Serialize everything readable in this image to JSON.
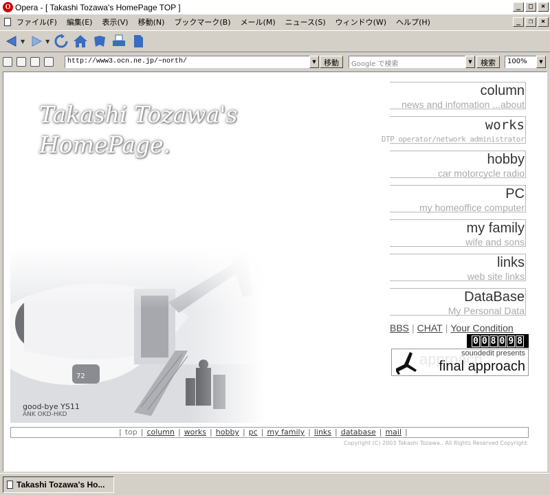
{
  "window": {
    "title": "Opera - [ Takashi Tozawa's HomePage TOP ]",
    "app_icon_glyph": "O"
  },
  "menu": {
    "items": [
      "ファイル(F)",
      "編集(E)",
      "表示(V)",
      "移動(N)",
      "ブックマーク(B)",
      "メール(M)",
      "ニュース(S)",
      "ウィンドウ(W)",
      "ヘルプ(H)"
    ]
  },
  "toolbar": {
    "icons": [
      "back-icon",
      "forward-icon",
      "reload-icon",
      "home-icon",
      "hotlist-icon",
      "print-icon",
      "page-icon"
    ]
  },
  "address": {
    "url": "http://www3.ocn.ne.jp/~north/",
    "go_label": "移動",
    "search_placeholder": "Google で検索",
    "search_label": "検索",
    "zoom": "100%"
  },
  "page": {
    "logo_line1": "Takashi Tozawa's",
    "logo_line2": "HomePage.",
    "caption_title": "good-bye YS11",
    "caption_sub": "ANK OKD-HKD",
    "nav": [
      {
        "title": "column",
        "sub": "news and infomation ...about"
      },
      {
        "title": "works",
        "sub": "DTP operator/network administrator"
      },
      {
        "title": "hobby",
        "sub": "car motorcycle radio"
      },
      {
        "title": "PC",
        "sub": "my homeoffice computer"
      },
      {
        "title": "my family",
        "sub": "wife and sons"
      },
      {
        "title": "links",
        "sub": "web site links"
      },
      {
        "title": "DataBase",
        "sub": "My Personal Data"
      }
    ],
    "quicklinks": {
      "bbs": "BBS",
      "chat": "CHAT",
      "condition": "Your Condition"
    },
    "counter_digits": [
      "0",
      "0",
      "8",
      "0",
      "9",
      "8"
    ],
    "banner": {
      "ghost": "approach",
      "line1": "soundedit presents",
      "line2": "final approach"
    },
    "footer_links": [
      "top",
      "column",
      "works",
      "hobby",
      "pc",
      "my family",
      "links",
      "database",
      "mail"
    ],
    "copyright": "Copyright (C) 2003 Takashi Tozawa.. All Rights Reserved Copyright."
  },
  "status": {
    "tab_title": "Takashi Tozawa's Ho..."
  },
  "colors": {
    "window_bg": "#d4d0c8",
    "page_bg": "#ffffff",
    "nav_title": "#333333",
    "nav_sub": "#aaaaaa"
  }
}
